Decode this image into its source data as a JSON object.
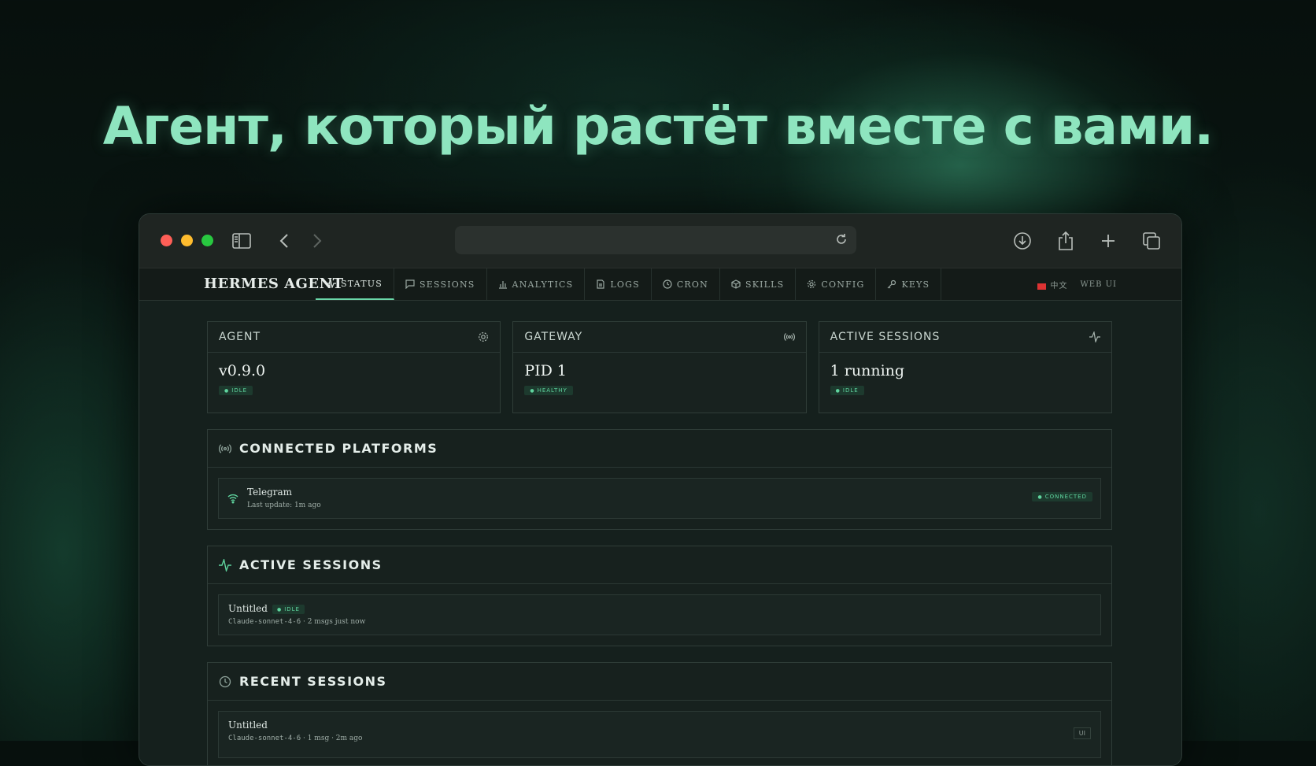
{
  "headline": "Агент, который растёт вместе с вами.",
  "browser": {
    "url": ""
  },
  "app": {
    "brand": "HERMES AGENT",
    "tabs": [
      {
        "label": "STATUS",
        "icon": "activity-icon",
        "active": true
      },
      {
        "label": "SESSIONS",
        "icon": "chat-icon"
      },
      {
        "label": "ANALYTICS",
        "icon": "bar-chart-icon"
      },
      {
        "label": "LOGS",
        "icon": "file-icon"
      },
      {
        "label": "CRON",
        "icon": "clock-icon"
      },
      {
        "label": "SKILLS",
        "icon": "package-icon"
      },
      {
        "label": "CONFIG",
        "icon": "gear-icon"
      },
      {
        "label": "KEYS",
        "icon": "key-icon"
      }
    ],
    "lang_label": "中文",
    "mode_label": "WEB UI"
  },
  "cards": [
    {
      "title": "AGENT",
      "icon": "gear-icon",
      "value": "v0.9.0",
      "badge": "IDLE"
    },
    {
      "title": "GATEWAY",
      "icon": "radio-icon",
      "value": "PID 1",
      "badge": "HEALTHY"
    },
    {
      "title": "ACTIVE SESSIONS",
      "icon": "activity-icon",
      "value": "1 running",
      "badge": "IDLE"
    }
  ],
  "platforms": {
    "title": "CONNECTED PLATFORMS",
    "items": [
      {
        "name": "Telegram",
        "meta": "Last update: 1m ago",
        "status": "CONNECTED"
      }
    ]
  },
  "active_sessions": {
    "title": "ACTIVE SESSIONS",
    "items": [
      {
        "name": "Untitled",
        "badge": "IDLE",
        "model": "Claude-sonnet-4-6",
        "meta": " · 2 msgs just now"
      }
    ]
  },
  "recent_sessions": {
    "title": "RECENT SESSIONS",
    "items": [
      {
        "name": "Untitled",
        "model": "Claude-sonnet-4-6",
        "meta": " · 1 msg · 2m ago",
        "tag": "UI"
      }
    ]
  },
  "colors": {
    "accent": "#6ad7a8",
    "headline": "#8ee5bf",
    "badge_bg": "#1d3a2e"
  }
}
